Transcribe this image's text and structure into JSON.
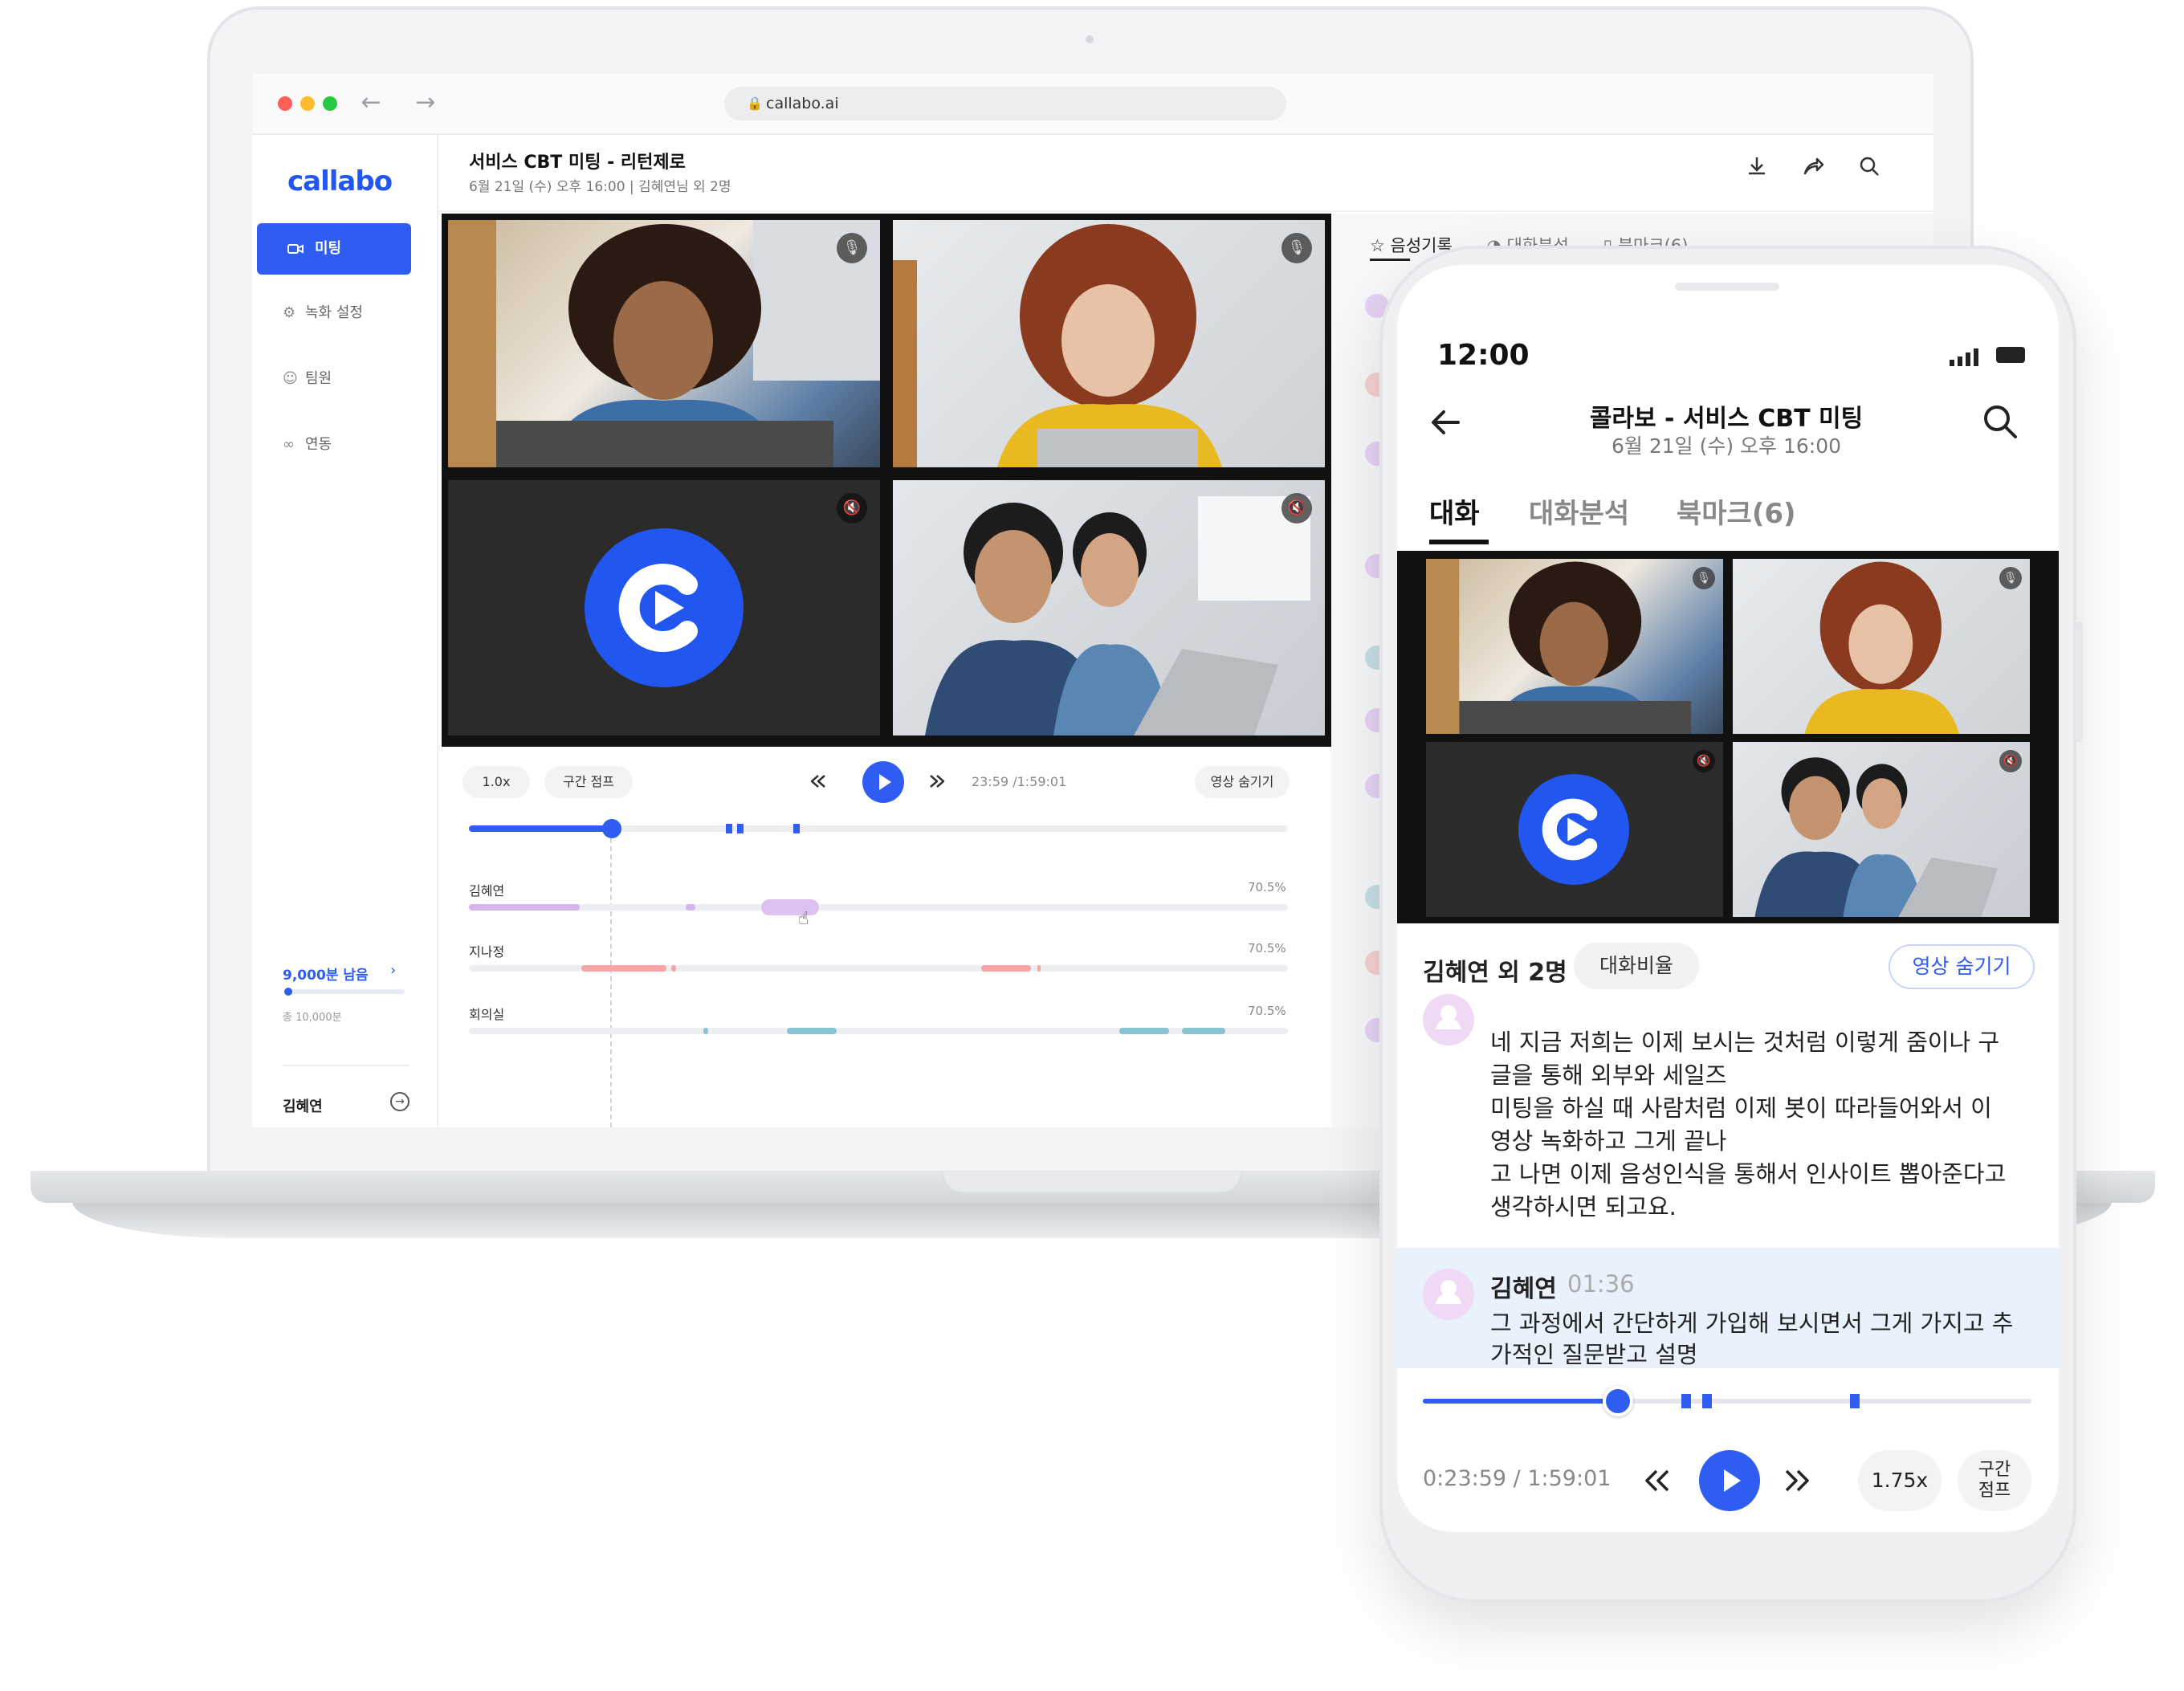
{
  "browser": {
    "url": "callabo.ai"
  },
  "sidebar": {
    "logo": "callabo",
    "items": [
      {
        "label": "미팅",
        "icon": "video-icon"
      },
      {
        "label": "녹화 설정",
        "icon": "gear-icon"
      },
      {
        "label": "팀원",
        "icon": "person-icon"
      },
      {
        "label": "연동",
        "icon": "link-icon"
      }
    ],
    "minutes_left": "9,000분 남음",
    "minutes_total": "총 10,000분",
    "minutes_used_fraction": 0.1,
    "user": "김혜연"
  },
  "meeting": {
    "title": "서비스 CBT 미팅 - 리턴제로",
    "subtitle": "6월 21일 (수) 오후 16:00  |  김혜연님 외 2명"
  },
  "player": {
    "speed": "1.0x",
    "jump": "구간 점프",
    "time": "23:59 /1:59:01",
    "hide_video": "영상 숨기기",
    "progress_fraction": 0.18
  },
  "speakers": [
    {
      "name": "김혜연",
      "pct": "70.5%",
      "color": "#d6b4f0"
    },
    {
      "name": "지나정",
      "pct": "70.5%",
      "color": "#f4a5a5"
    },
    {
      "name": "회의실",
      "pct": "70.5%",
      "color": "#88c4d2"
    }
  ],
  "right_panel": {
    "tabs": [
      "음성기록",
      "대화분석",
      "북마크(6)"
    ]
  },
  "phone": {
    "clock": "12:00",
    "title": "콜라보 - 서비스 CBT 미팅",
    "subtitle": "6월 21일 (수) 오후 16:00",
    "tabs": [
      "대화",
      "대화분석",
      "북마크(6)"
    ],
    "participants": "김혜연 외 2명",
    "ratio_btn": "대화비율",
    "hide_btn": "영상 숨기기",
    "messages": [
      {
        "lines": [
          "네 지금 저희는 이제 보시는 것처럼 이렇게 줌이나 구",
          "글을 통해 외부와 세일즈",
          "미팅을 하실 때 사람처럼 이제 봇이 따라들어와서 이",
          "영상 녹화하고 그게 끝나",
          "고 나면 이제 음성인식을 통해서 인사이트 뽑아준다고",
          "생각하시면 되고요."
        ]
      },
      {
        "name": "김혜연",
        "time": "01:36",
        "lines": [
          "그 과정에서 간단하게 가입해 보시면서 그게 가지고 추",
          "가적인 질문받고 설명"
        ]
      }
    ],
    "player_time": "0:23:59 / 1:59:01",
    "speed": "1.75x",
    "jump_line1": "구간",
    "jump_line2": "점프",
    "progress_fraction": 0.2
  },
  "colors": {
    "accent": "#2f5df2",
    "brand": "#2156f0"
  }
}
